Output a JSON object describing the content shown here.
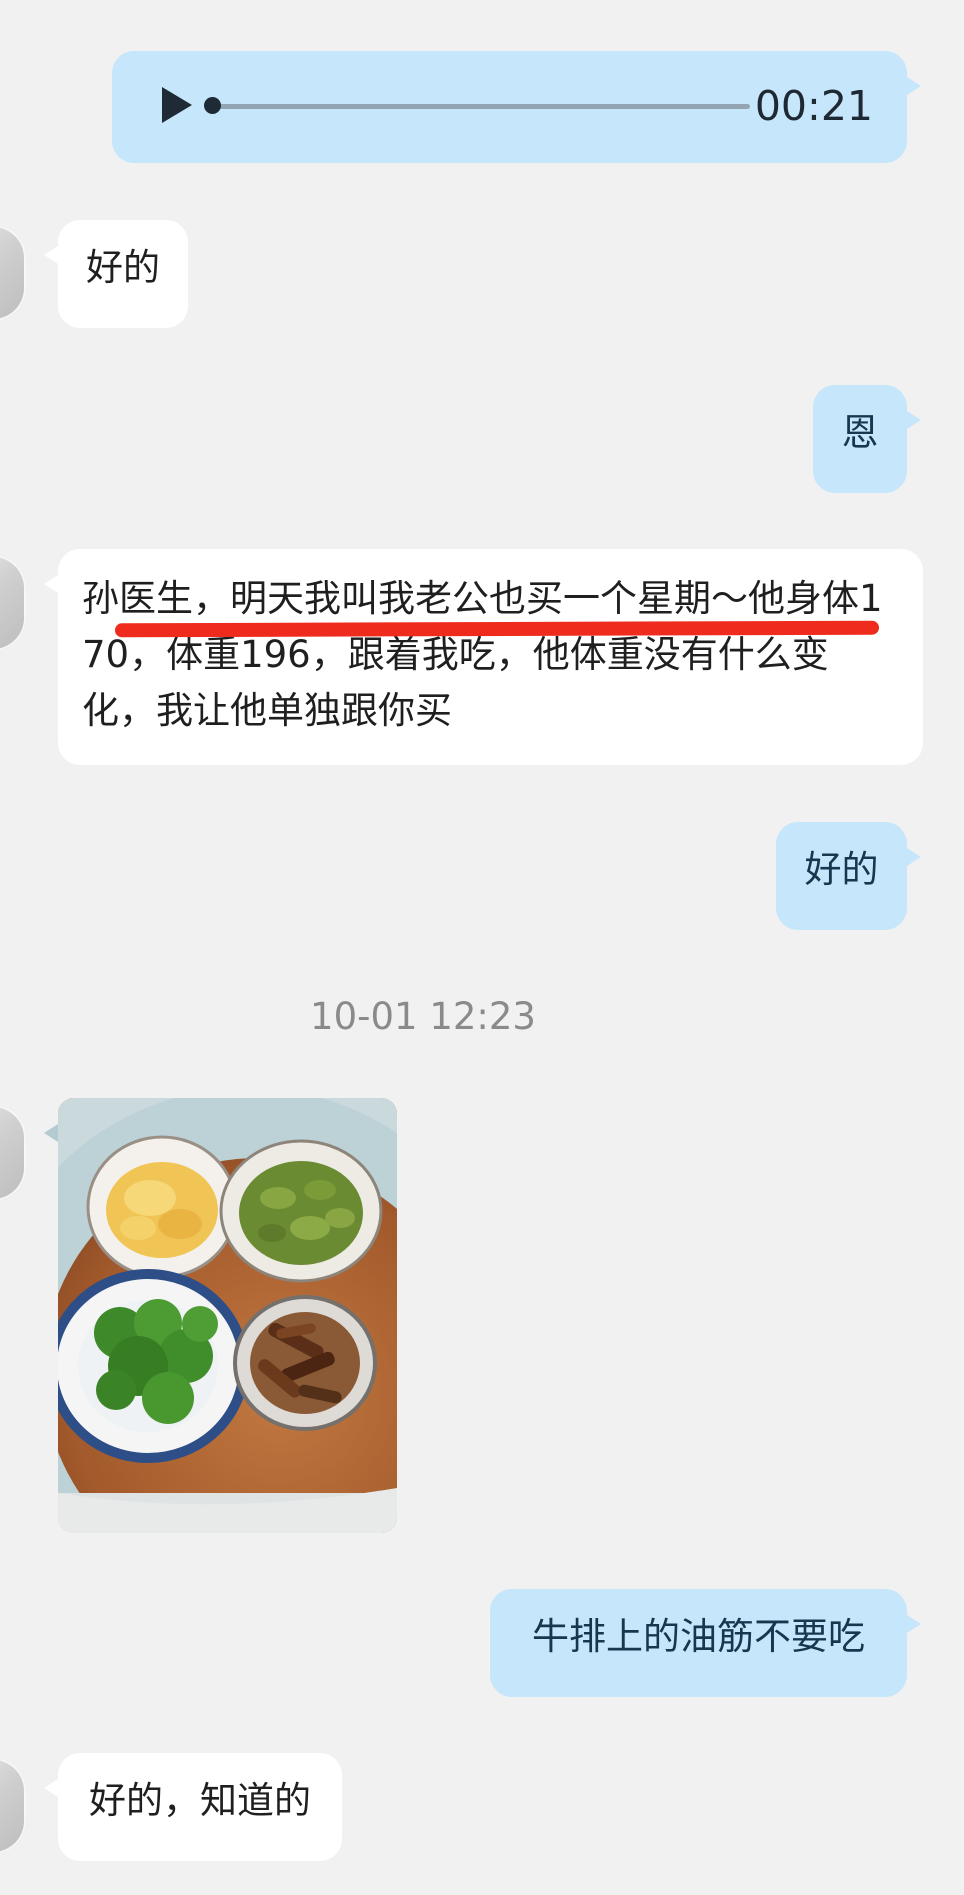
{
  "messages": {
    "voice_duration": "00:21",
    "m1": "好的",
    "m2": "恩",
    "m3": "孙医生，明天我叫我老公也买一个星期～他身体170，体重196，跟着我吃，他体重没有什么变化，我让他单独跟你买",
    "m4": "好的",
    "timestamp": "10-01 12:23",
    "m5": "牛排上的油筋不要吃",
    "m6": "好的，知道的"
  },
  "colors": {
    "background": "#f1f1f1",
    "incoming_bubble": "#ffffff",
    "outgoing_bubble": "#c6e6fb",
    "highlight_underline": "#ee2b1c"
  },
  "icons": {
    "play": "play-icon",
    "photo": "food-photo"
  }
}
